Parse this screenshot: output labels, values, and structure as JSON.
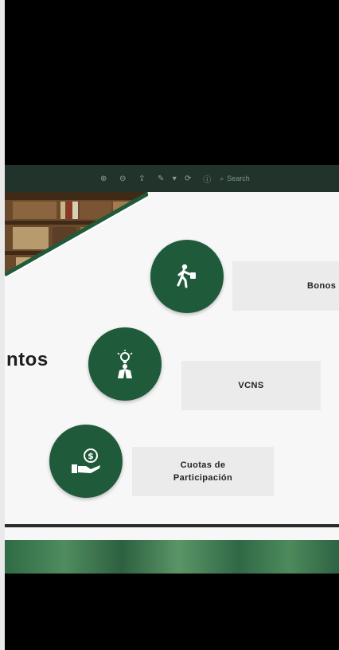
{
  "toolbar": {
    "icons": [
      "zoom-in-icon",
      "zoom-out-icon",
      "share-icon",
      "markup-icon",
      "chevron-down-icon",
      "rotate-icon",
      "info-icon",
      "search-icon"
    ],
    "search_placeholder": "Search"
  },
  "slide": {
    "heading": "ntos",
    "items": [
      {
        "label": "Bonos",
        "icon": "walking-person-icon"
      },
      {
        "label": "VCNS",
        "icon": "idea-person-icon"
      },
      {
        "label": "Cuotas de Participación",
        "label_line1": "Cuotas de",
        "label_line2": "Participación",
        "icon": "money-hand-icon"
      }
    ]
  },
  "colors": {
    "accent_green": "#1f5a3a",
    "toolbar_bg": "#21332a",
    "box_bg": "#ebebeb"
  }
}
